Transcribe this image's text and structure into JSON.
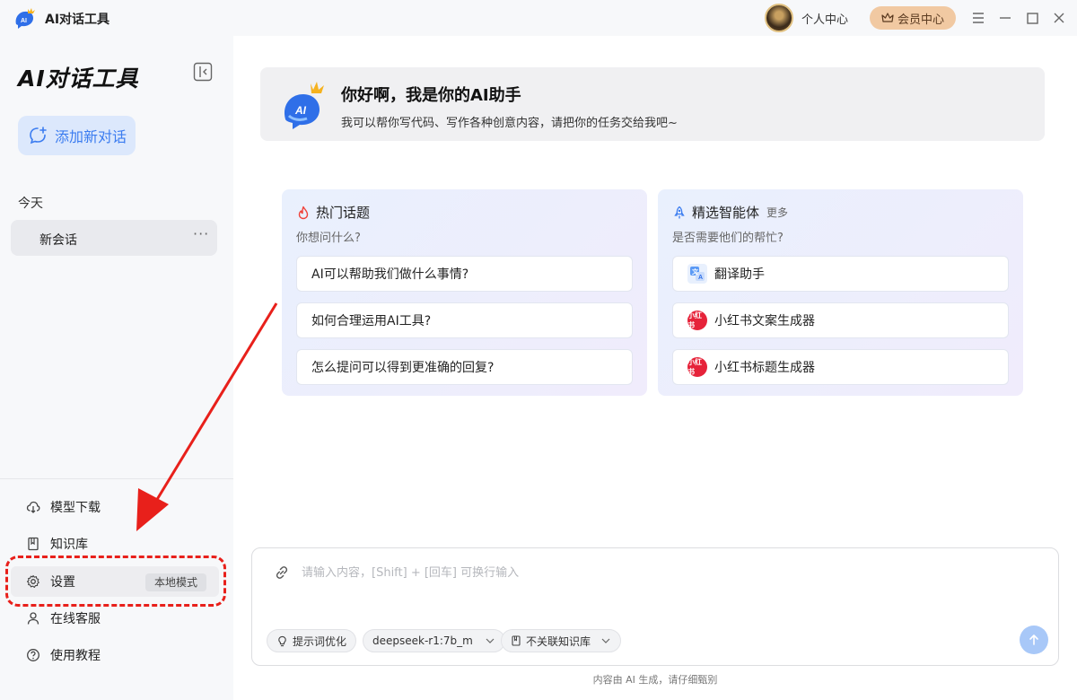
{
  "titlebar": {
    "app_name": "AI对话工具",
    "user_center": "个人中心",
    "vip_label": "会员中心"
  },
  "sidebar": {
    "title": "AI对话工具",
    "new_chat_label": "添加新对话",
    "group_today": "今天",
    "sessions": [
      {
        "name": "新会话",
        "more": "···"
      }
    ],
    "bottom_items": [
      {
        "label": "模型下载",
        "icon": "cloud-download-icon"
      },
      {
        "label": "知识库",
        "icon": "book-icon"
      },
      {
        "label": "设置",
        "icon": "gear-icon",
        "badge": "本地模式"
      },
      {
        "label": "在线客服",
        "icon": "user-icon"
      },
      {
        "label": "使用教程",
        "icon": "help-circle-icon"
      }
    ]
  },
  "welcome": {
    "title": "你好啊，我是你的AI助手",
    "subtitle": "我可以帮你写代码、写作各种创意内容，请把你的任务交给我吧~"
  },
  "hot_topics": {
    "title": "热门话题",
    "subtitle": "你想问什么?",
    "items": [
      "AI可以帮助我们做什么事情?",
      "如何合理运用AI工具?",
      "怎么提问可以得到更准确的回复?"
    ]
  },
  "agents": {
    "title": "精选智能体",
    "more": "更多",
    "subtitle": "是否需要他们的帮忙?",
    "items": [
      {
        "label": "翻译助手",
        "icon": "translate-icon"
      },
      {
        "label": "小红书文案生成器",
        "icon": "xiaohongshu-icon",
        "icon_text": "小红书"
      },
      {
        "label": "小红书标题生成器",
        "icon": "xiaohongshu-icon",
        "icon_text": "小红书"
      }
    ]
  },
  "input": {
    "placeholder": "请输入内容，[Shift] + [回车] 可换行输入",
    "value": "",
    "prompt_opt": "提示词优化",
    "model": "deepseek-r1:7b_m",
    "knowledge": "不关联知识库"
  },
  "disclaimer": "内容由 AI 生成，请仔细甄别",
  "colors": {
    "accent": "#3b7cf0",
    "vip": "#f1c9a2",
    "annotation": "#e8201b",
    "xiaohongshu": "#e6233a"
  }
}
